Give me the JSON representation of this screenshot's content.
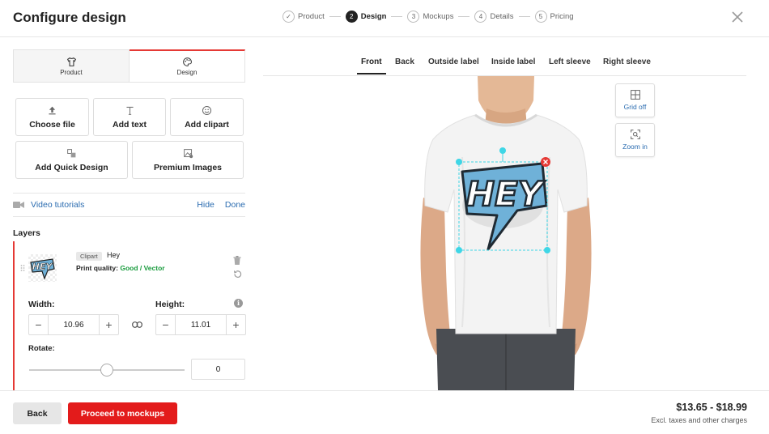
{
  "header": {
    "title": "Configure design",
    "steps": [
      {
        "num": "✓",
        "label": "Product"
      },
      {
        "num": "2",
        "label": "Design"
      },
      {
        "num": "3",
        "label": "Mockups"
      },
      {
        "num": "4",
        "label": "Details"
      },
      {
        "num": "5",
        "label": "Pricing"
      }
    ],
    "active_step": "Design"
  },
  "mode_tabs": [
    {
      "label": "Product",
      "icon": "tshirt-icon"
    },
    {
      "label": "Design",
      "icon": "palette-icon"
    }
  ],
  "active_mode": "Design",
  "tools": {
    "choose_file": "Choose file",
    "add_text": "Add text",
    "add_clipart": "Add clipart",
    "add_quick_design": "Add Quick Design",
    "premium_images": "Premium Images"
  },
  "video": {
    "label": "Video tutorials",
    "hide": "Hide",
    "done": "Done"
  },
  "layers": {
    "title": "Layers",
    "items": [
      {
        "badge": "Clipart",
        "name": "Hey",
        "quality_label": "Print quality:",
        "quality_value": "Good / Vector"
      }
    ]
  },
  "dimensions": {
    "width_label": "Width:",
    "width_value": "10.96",
    "height_label": "Height:",
    "height_value": "11.01",
    "rotate_label": "Rotate:",
    "rotate_value": "0",
    "minus": "−",
    "plus": "+"
  },
  "view_tabs": [
    "Front",
    "Back",
    "Outside label",
    "Inside label",
    "Left sleeve",
    "Right sleeve"
  ],
  "active_view": "Front",
  "canvas_tools": {
    "grid": "Grid off",
    "zoom": "Zoom in"
  },
  "design_text": "HEY",
  "footer": {
    "back": "Back",
    "proceed": "Proceed to mockups",
    "price": "$13.65 - $18.99",
    "price_note": "Excl. taxes and other charges"
  },
  "colors": {
    "accent": "#e31b1b",
    "link": "#2b6cb0",
    "good": "#1a9c3e",
    "selection": "#3ed6e6",
    "design_blue": "#6fb1d8"
  }
}
